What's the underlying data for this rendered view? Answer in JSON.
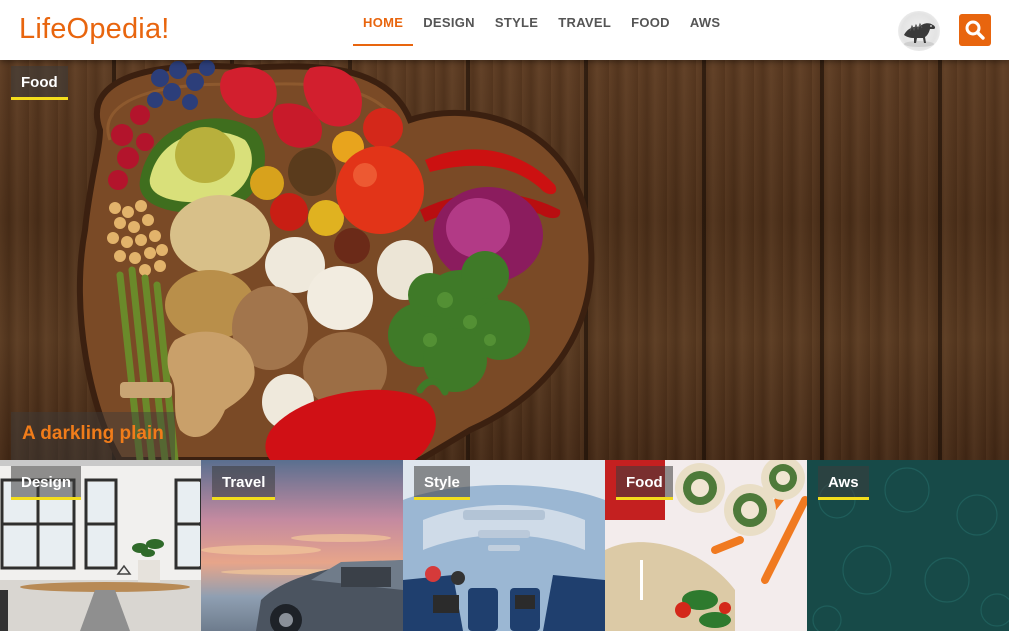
{
  "site": {
    "logo": "LifeOpedia!"
  },
  "nav": {
    "items": [
      {
        "label": "HOME"
      },
      {
        "label": "DESIGN"
      },
      {
        "label": "STYLE"
      },
      {
        "label": "TRAVEL"
      },
      {
        "label": "FOOD"
      },
      {
        "label": "AWS"
      }
    ],
    "active_index": 0
  },
  "header": {
    "avatar_icon": "dinosaur-sketch-avatar",
    "search_icon": "search-icon"
  },
  "hero": {
    "category": "Food",
    "title": "A darkling plain"
  },
  "thumbs": [
    {
      "category": "Design"
    },
    {
      "category": "Travel"
    },
    {
      "category": "Style"
    },
    {
      "category": "Food"
    },
    {
      "category": "Aws"
    }
  ],
  "colors": {
    "accent": "#e8650e",
    "tag_underline": "#f3dd1c",
    "hero_title": "#f07c1a"
  }
}
